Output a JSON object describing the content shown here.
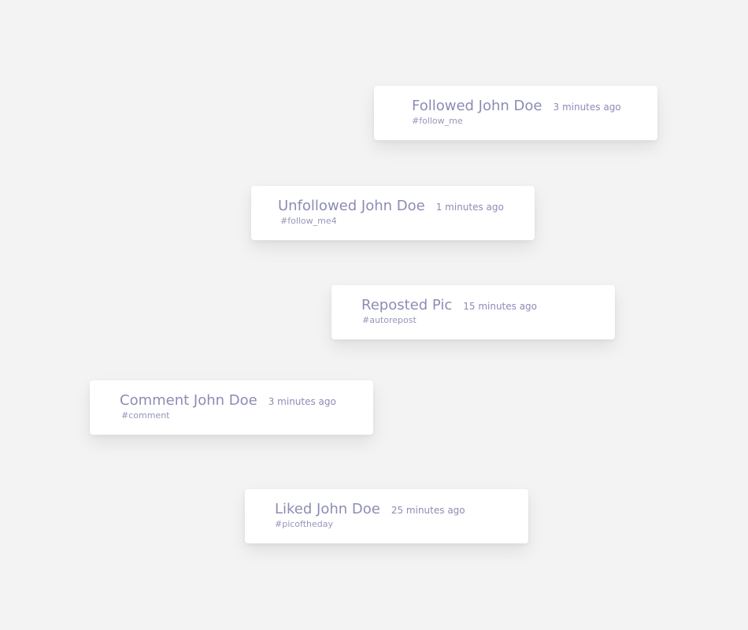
{
  "activities": [
    {
      "title": "Followed John Doe",
      "time": "3 minutes ago",
      "tag": "#follow_me"
    },
    {
      "title": "Unfollowed John Doe",
      "time": "1 minutes ago",
      "tag": "#follow_me4"
    },
    {
      "title": "Reposted Pic",
      "time": "15 minutes ago",
      "tag": "#autorepost"
    },
    {
      "title": "Comment John Doe",
      "time": "3 minutes ago",
      "tag": "#comment"
    },
    {
      "title": "Liked John Doe",
      "time": "25 minutes ago",
      "tag": "#picoftheday"
    }
  ],
  "colors": {
    "background": "#f3f3f3",
    "card": "#ffffff",
    "text": "#8c8cb5"
  }
}
